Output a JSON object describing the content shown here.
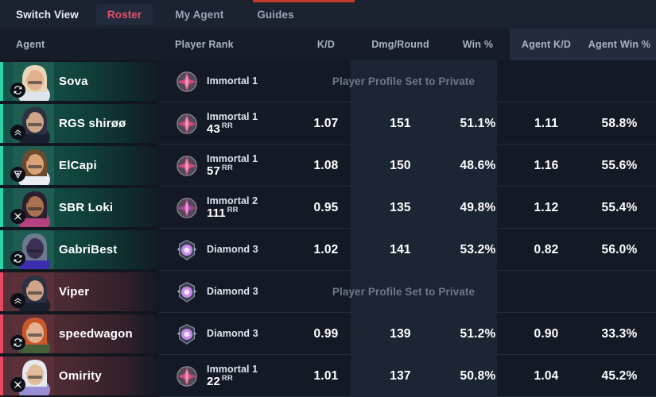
{
  "navbar": {
    "switch_view_label": "Switch View",
    "tabs": [
      {
        "label": "Roster",
        "active": true
      },
      {
        "label": "My Agent",
        "active": false
      },
      {
        "label": "Guides",
        "active": false
      }
    ],
    "accent_color": "#c0392b"
  },
  "columns": {
    "agent": "Agent",
    "player_rank": "Player Rank",
    "kd": "K/D",
    "dmg_round": "Dmg/Round",
    "win_pct": "Win %",
    "agent_kd": "Agent K/D",
    "agent_win_pct": "Agent Win %"
  },
  "messages": {
    "private_profile": "Player Profile Set to Private",
    "rr_unit": "RR"
  },
  "colors": {
    "team_accent": "#2ad6a5",
    "enemy_accent": "#e8475f",
    "active_tab": "#e0516b",
    "highlight_column": "#1c2533"
  },
  "rows": [
    {
      "agent": "Sova",
      "role": "initiator-icon",
      "side": "team",
      "rank_tier": "Immortal 1",
      "rank_rr": null,
      "private": true,
      "kd": "",
      "dmg_round": "",
      "win_pct": "",
      "agent_kd": "",
      "agent_win_pct": ""
    },
    {
      "agent": "RGS shirøø",
      "role": "duelist-icon",
      "side": "team",
      "rank_tier": "Immortal 1",
      "rank_rr": "43",
      "private": false,
      "kd": "1.07",
      "dmg_round": "151",
      "win_pct": "51.1%",
      "agent_kd": "1.11",
      "agent_win_pct": "58.8%"
    },
    {
      "agent": "ElCapi",
      "role": "sentinel-icon",
      "side": "team",
      "rank_tier": "Immortal 1",
      "rank_rr": "57",
      "private": false,
      "kd": "1.08",
      "dmg_round": "150",
      "win_pct": "48.6%",
      "agent_kd": "1.16",
      "agent_win_pct": "55.6%"
    },
    {
      "agent": "SBR Loki",
      "role": "controller-icon",
      "side": "team",
      "rank_tier": "Immortal 2",
      "rank_rr": "111",
      "private": false,
      "kd": "0.95",
      "dmg_round": "135",
      "win_pct": "49.8%",
      "agent_kd": "1.12",
      "agent_win_pct": "55.4%"
    },
    {
      "agent": "GabriBest",
      "role": "initiator-icon",
      "side": "team",
      "rank_tier": "Diamond 3",
      "rank_rr": null,
      "private": false,
      "kd": "1.02",
      "dmg_round": "141",
      "win_pct": "53.2%",
      "agent_kd": "0.82",
      "agent_win_pct": "56.0%"
    },
    {
      "agent": "Viper",
      "role": "duelist-icon",
      "side": "enemy",
      "rank_tier": "Diamond 3",
      "rank_rr": null,
      "private": true,
      "kd": "",
      "dmg_round": "",
      "win_pct": "",
      "agent_kd": "",
      "agent_win_pct": ""
    },
    {
      "agent": "speedwagon",
      "role": "initiator-icon",
      "side": "enemy",
      "rank_tier": "Diamond 3",
      "rank_rr": null,
      "private": false,
      "kd": "0.99",
      "dmg_round": "139",
      "win_pct": "51.2%",
      "agent_kd": "0.90",
      "agent_win_pct": "33.3%"
    },
    {
      "agent": "Omirity",
      "role": "controller-icon",
      "side": "enemy",
      "rank_tier": "Immortal 1",
      "rank_rr": "22",
      "private": false,
      "kd": "1.01",
      "dmg_round": "137",
      "win_pct": "50.8%",
      "agent_kd": "1.04",
      "agent_win_pct": "45.2%"
    }
  ]
}
